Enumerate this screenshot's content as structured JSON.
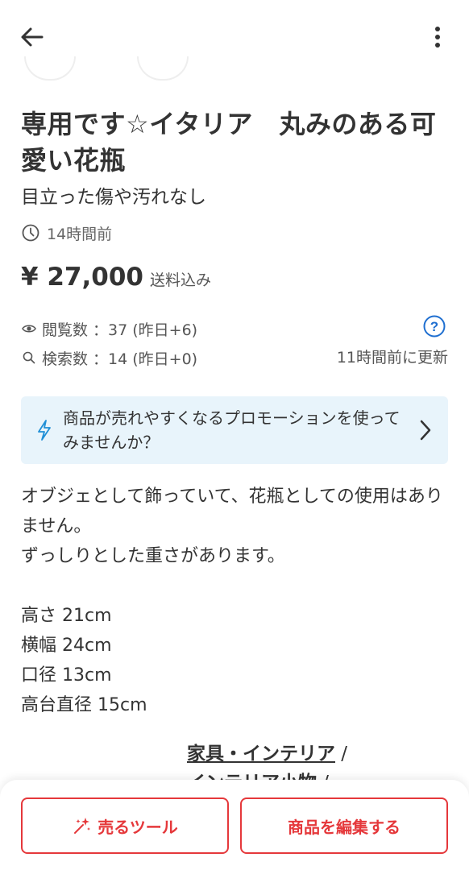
{
  "header": {
    "back_icon": "arrow-left-icon",
    "more_icon": "more-vertical-icon"
  },
  "item": {
    "title": "専用です☆イタリア　丸みのある可愛い花瓶",
    "condition": "目立った傷や汚れなし",
    "posted": "14時間前",
    "price": "¥ 27,000",
    "price_note": "送料込み"
  },
  "stats": {
    "views_label": "閲覧数 ：37 (昨日+6)",
    "search_label": "検索数 ：14 (昨日+0)",
    "updated": "11時間前に更新"
  },
  "promo": {
    "text": "商品が売れやすくなるプロモーションを使ってみませんか？"
  },
  "description": {
    "lines": [
      "オブジェとして飾っていて、花瓶としての使用はありません。",
      "ずっしりとした重さがあります。",
      "",
      "高さ 21cm",
      "横幅 24cm",
      "口径 13cm",
      "高台直径 15cm"
    ]
  },
  "category": {
    "level1": "家具・インテリア",
    "level2": "インテリア小物",
    "separator": " /"
  },
  "actions": {
    "sell_tool": "売るツール",
    "edit": "商品を編集する"
  },
  "colors": {
    "accent": "#e5383b",
    "link_blue": "#1f6fd0",
    "promo_bg": "#e8f4fb"
  }
}
